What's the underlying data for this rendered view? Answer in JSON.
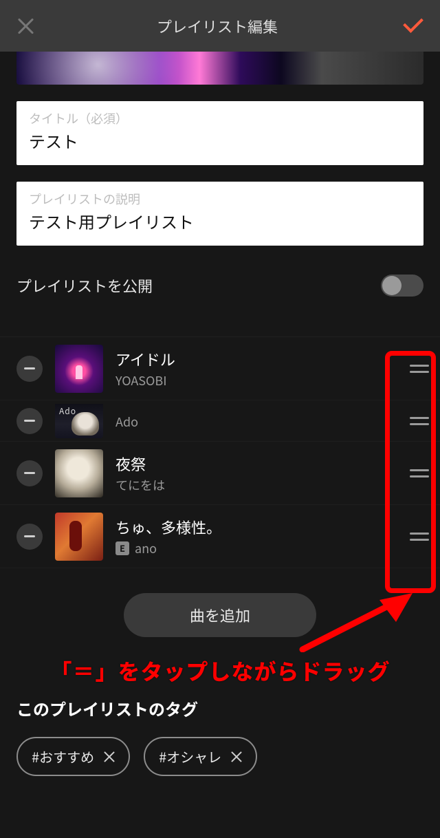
{
  "header": {
    "title": "プレイリスト編集"
  },
  "fields": {
    "title_label": "タイトル（必須）",
    "title_value": "テスト",
    "desc_label": "プレイリストの説明",
    "desc_value": "テスト用プレイリスト"
  },
  "publish": {
    "label": "プレイリストを公開",
    "on": false
  },
  "tracks": [
    {
      "title": "アイドル",
      "artist": "YOASOBI",
      "explicit": false
    },
    {
      "title": "",
      "artist": "Ado",
      "explicit": false
    },
    {
      "title": "夜祭",
      "artist": "てにをは",
      "explicit": false
    },
    {
      "title": "ちゅ、多様性。",
      "artist": "ano",
      "explicit": true
    }
  ],
  "add_button": "曲を追加",
  "tags_heading": "このプレイリストのタグ",
  "tags": [
    "#おすすめ",
    "#オシャレ"
  ],
  "annotation": "「＝」をタップしながらドラッグ"
}
